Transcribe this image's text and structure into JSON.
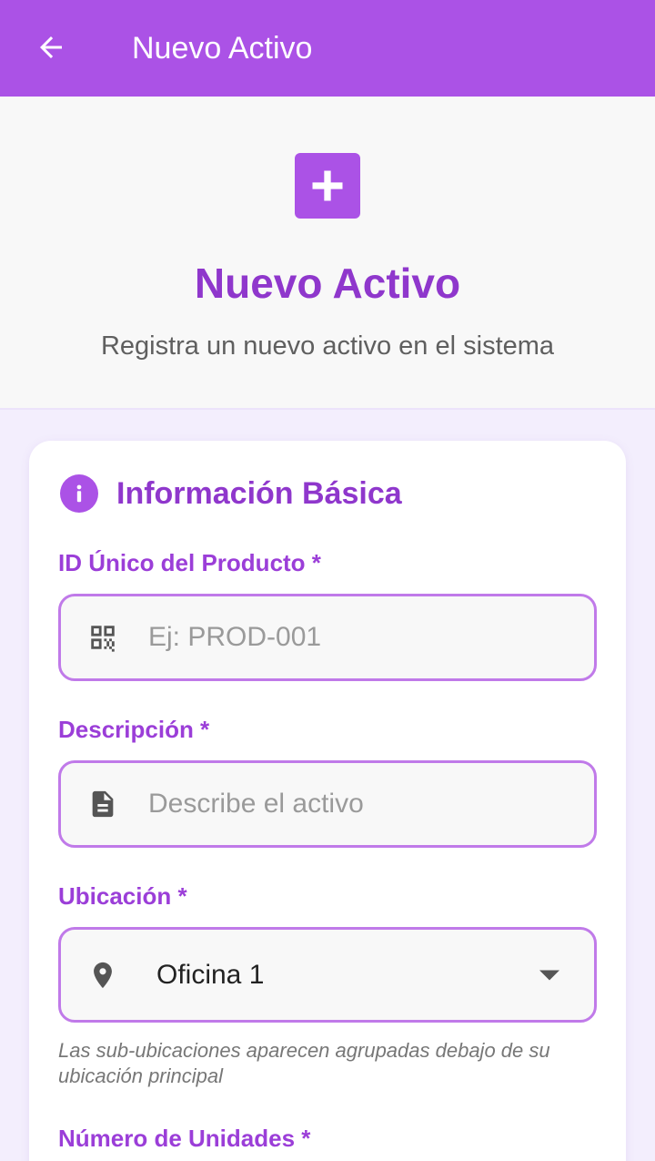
{
  "appbar": {
    "title": "Nuevo Activo",
    "back_icon": "arrow-back-icon"
  },
  "hero": {
    "icon": "add-box-icon",
    "title": "Nuevo Activo",
    "subtitle": "Registra un nuevo activo en el sistema"
  },
  "section": {
    "icon": "info-icon",
    "title": "Información Básica"
  },
  "fields": {
    "product_id": {
      "label": "ID Único del Producto *",
      "placeholder": "Ej: PROD-001",
      "icon": "qr-code-icon"
    },
    "description": {
      "label": "Descripción *",
      "placeholder": "Describe el activo",
      "icon": "document-icon"
    },
    "location": {
      "label": "Ubicación *",
      "value": "Oficina 1",
      "icon": "location-pin-icon",
      "hint": "Las sub-ubicaciones aparecen agrupadas debajo de su ubicación principal"
    },
    "units": {
      "label": "Número de Unidades *"
    }
  },
  "colors": {
    "primary": "#ab52e6",
    "accent_text": "#8f37cc",
    "field_border": "#c07ae9"
  }
}
